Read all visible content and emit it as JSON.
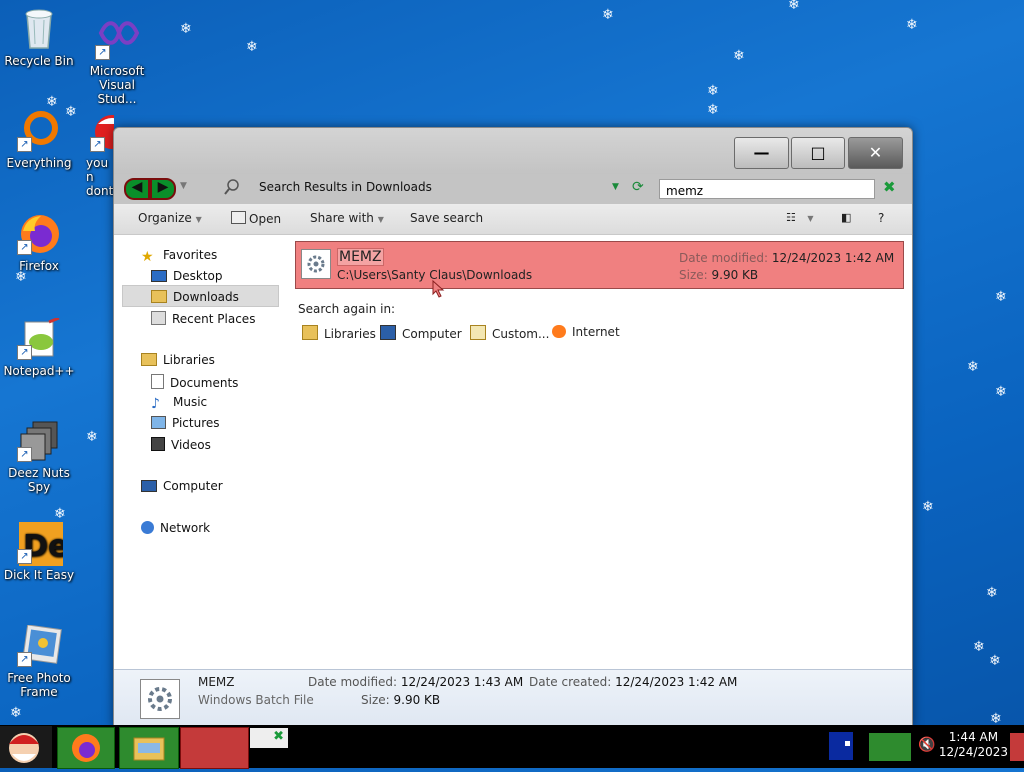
{
  "desktop": {
    "icons": [
      {
        "label": "Recycle Bin"
      },
      {
        "label": "Microsoft Visual Stud..."
      },
      {
        "label": "Everything"
      },
      {
        "label": "you n dont"
      },
      {
        "label": "Firefox"
      },
      {
        "label": "Notepad++"
      },
      {
        "label": "Deez Nuts Spy"
      },
      {
        "label": "Dick It Easy"
      },
      {
        "label": "Free Photo Frame"
      }
    ]
  },
  "window": {
    "buttons": {
      "minimize": "—",
      "maximize": "□",
      "close": "✕"
    },
    "address": "Search Results in Downloads",
    "search_value": "memz",
    "toolbar": {
      "organize": "Organize",
      "open": "Open",
      "share_with": "Share with",
      "save_search": "Save search",
      "help": "?"
    },
    "nav": {
      "favorites": "Favorites",
      "desktop": "Desktop",
      "downloads": "Downloads",
      "recent_places": "Recent Places",
      "libraries": "Libraries",
      "documents": "Documents",
      "music": "Music",
      "pictures": "Pictures",
      "videos": "Videos",
      "computer": "Computer",
      "network": "Network"
    },
    "result": {
      "name": "MEMZ",
      "path": "C:\\Users\\Santy Claus\\Downloads",
      "date_modified_label": "Date modified:",
      "date_modified": "12/24/2023 1:42 AM",
      "size_label": "Size:",
      "size": "9.90 KB"
    },
    "search_again": {
      "label": "Search again in:",
      "items": [
        "Libraries",
        "Computer",
        "Custom...",
        "Internet"
      ]
    },
    "details": {
      "name": "MEMZ",
      "type": "Windows Batch File",
      "date_modified_label": "Date modified:",
      "date_modified": "12/24/2023 1:43 AM",
      "size_label": "Size:",
      "size": "9.90 KB",
      "date_created_label": "Date created:",
      "date_created": "12/24/2023 1:42 AM"
    }
  },
  "taskbar": {
    "time": "1:44 AM",
    "date": "12/24/2023"
  },
  "colors": {
    "desktop": "#0b64c0",
    "result_highlight": "#f08080",
    "taskbar": "#000000",
    "taskbar_app": "#2e8b2e"
  }
}
